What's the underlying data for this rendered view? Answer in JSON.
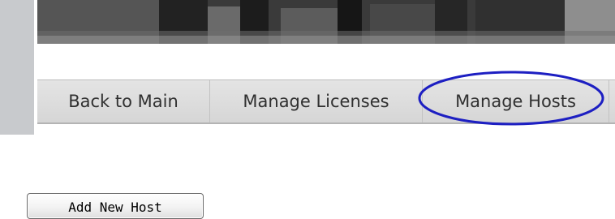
{
  "navigation": {
    "items": [
      {
        "label": "Back to Main"
      },
      {
        "label": "Manage Licenses"
      },
      {
        "label": "Manage Hosts"
      }
    ],
    "highlight_color": "#1d1fc2"
  },
  "actions": {
    "add_host_label": "Add New Host"
  }
}
